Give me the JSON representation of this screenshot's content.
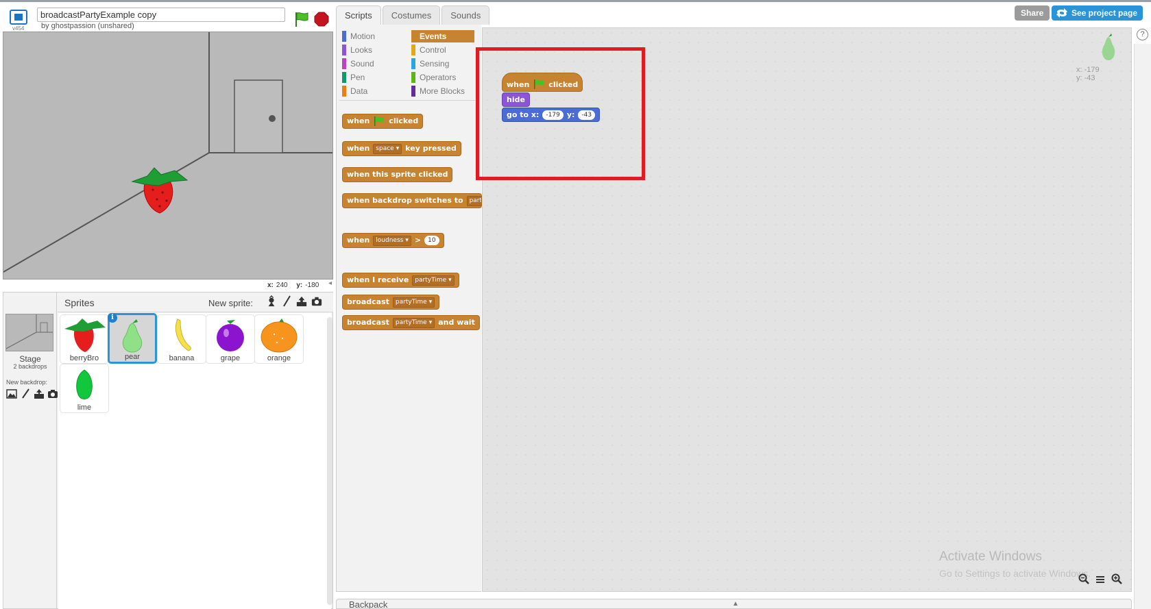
{
  "project": {
    "title": "broadcastPartyExample copy",
    "byline": "by ghostpassion (unshared)",
    "version": "v454"
  },
  "stage": {
    "coords": {
      "x_label": "x:",
      "x_value": "240",
      "y_label": "y:",
      "y_value": "-180"
    }
  },
  "stage_panel": {
    "label": "Stage",
    "backdrop_count": "2 backdrops",
    "new_backdrop_label": "New backdrop:"
  },
  "sprites": {
    "title": "Sprites",
    "new_sprite_label": "New sprite:",
    "items": [
      {
        "name": "berryBro",
        "selected": false
      },
      {
        "name": "pear",
        "selected": true
      },
      {
        "name": "banana",
        "selected": false
      },
      {
        "name": "grape",
        "selected": false
      },
      {
        "name": "orange",
        "selected": false
      },
      {
        "name": "lime",
        "selected": false
      }
    ],
    "info_glyph": "i"
  },
  "tabs": [
    {
      "label": "Scripts",
      "active": true
    },
    {
      "label": "Costumes",
      "active": false
    },
    {
      "label": "Sounds",
      "active": false
    }
  ],
  "categories": [
    {
      "label": "Motion",
      "color": "#4a6cd4"
    },
    {
      "label": "Looks",
      "color": "#8a55d7"
    },
    {
      "label": "Sound",
      "color": "#bb42c3"
    },
    {
      "label": "Pen",
      "color": "#0e9a6c"
    },
    {
      "label": "Data",
      "color": "#ee7d16"
    },
    {
      "label": "Events",
      "color": "#c88330",
      "active": true
    },
    {
      "label": "Control",
      "color": "#e1a91a"
    },
    {
      "label": "Sensing",
      "color": "#2ca5e2"
    },
    {
      "label": "Operators",
      "color": "#5cb712"
    },
    {
      "label": "More Blocks",
      "color": "#632d99"
    }
  ],
  "palette_blocks": {
    "when_flag": {
      "when": "when",
      "clicked": "clicked"
    },
    "when_key": {
      "when": "when",
      "key": "space",
      "rest": "key pressed"
    },
    "when_sprite_clicked": "when this sprite clicked",
    "when_backdrop": {
      "text": "when backdrop switches to",
      "value": "party"
    },
    "when_loudness": {
      "when": "when",
      "sensor": "loudness",
      "op": ">",
      "value": "10"
    },
    "when_receive": {
      "text": "when I receive",
      "message": "partyTime"
    },
    "broadcast": {
      "text": "broadcast",
      "message": "partyTime"
    },
    "broadcast_wait": {
      "text": "broadcast",
      "message": "partyTime",
      "rest": "and wait"
    }
  },
  "script": {
    "hat": {
      "when": "when",
      "clicked": "clicked"
    },
    "hide": "hide",
    "goto": {
      "text": "go to x:",
      "x": "-179",
      "y_label": "y:",
      "y": "-43"
    }
  },
  "sprite_info": {
    "x": "x: -179",
    "y": "y: -43"
  },
  "header_buttons": {
    "share": "Share",
    "see_project": "See project page",
    "help": "?"
  },
  "backpack": {
    "label": "Backpack"
  },
  "watermark": {
    "title": "Activate Windows",
    "subtitle": "Go to Settings to activate Windows."
  },
  "colors": {
    "events": "#c88330",
    "looks": "#8a55d7",
    "motion": "#4a6cd4",
    "highlight": "#e01b24",
    "accent": "#2a94d8"
  }
}
